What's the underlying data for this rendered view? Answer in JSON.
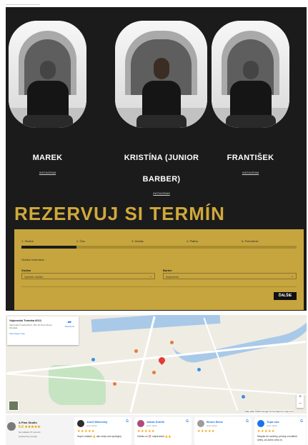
{
  "barbers": [
    {
      "name": "MAREK",
      "link": "INSTAGRAM"
    },
    {
      "name": "KRISTÍNA (JUNIOR BARBER)",
      "link": "INSTAGRAM"
    },
    {
      "name": "FRANTIŠEK",
      "link": "INSTAGRAM"
    }
  ],
  "reservation": {
    "title": "REZERVUJ SI TERMÍN",
    "steps": [
      "1. Služba",
      "2. Čas",
      "3. Detaily",
      "4. Platba",
      "5. Potvrdenie"
    ],
    "progress": 0.2,
    "hint": "Služba rezervácie",
    "service_label": "Služba",
    "service_value": "Vyberte službu",
    "barber_label": "Barber",
    "barber_value": "Akýkoľvek",
    "next_label": "ĎALŠIE"
  },
  "map": {
    "place_title": "Vajnorská Trnávka 8/1/1",
    "place_address": "Vajnorská Trnávka 8/1/1, 831 04 Nové Mesto, Slovakia",
    "view_larger": "View larger map",
    "directions": "Directions",
    "attribution": "Map data ©2024 Google  Terms  Report a map error"
  },
  "reviews_summary": {
    "name": "A Plan Studio",
    "rating": "5.0 ★★★★★",
    "count": "Na základe 27 recenzií",
    "powered": "powered by Google"
  },
  "reviews": [
    {
      "name": "Jozef Mlsovský",
      "time": "pred rokom",
      "stars": "★★★★★",
      "text": "Super chalani 👍 ako vždy som spokojný",
      "color": "#2d2d2d"
    },
    {
      "name": "Jakub Kráčik",
      "time": "pred rokom",
      "stars": "★★★★★",
      "text": "Všetko vo 💯 odporúčam 👍👍",
      "color": "#b04a7a"
    },
    {
      "name": "Bruno Brinc",
      "time": "pred rokom",
      "stars": "★★★★★",
      "text": "",
      "color": "#9c9c9c"
    },
    {
      "name": "Tupa ooo",
      "time": "pred rokom",
      "stars": "★★★★★",
      "text": "Navyše tie rozšírky, prístup a kvalitné strihy, za dobrú cenu to",
      "color": "#1a73e8"
    }
  ]
}
